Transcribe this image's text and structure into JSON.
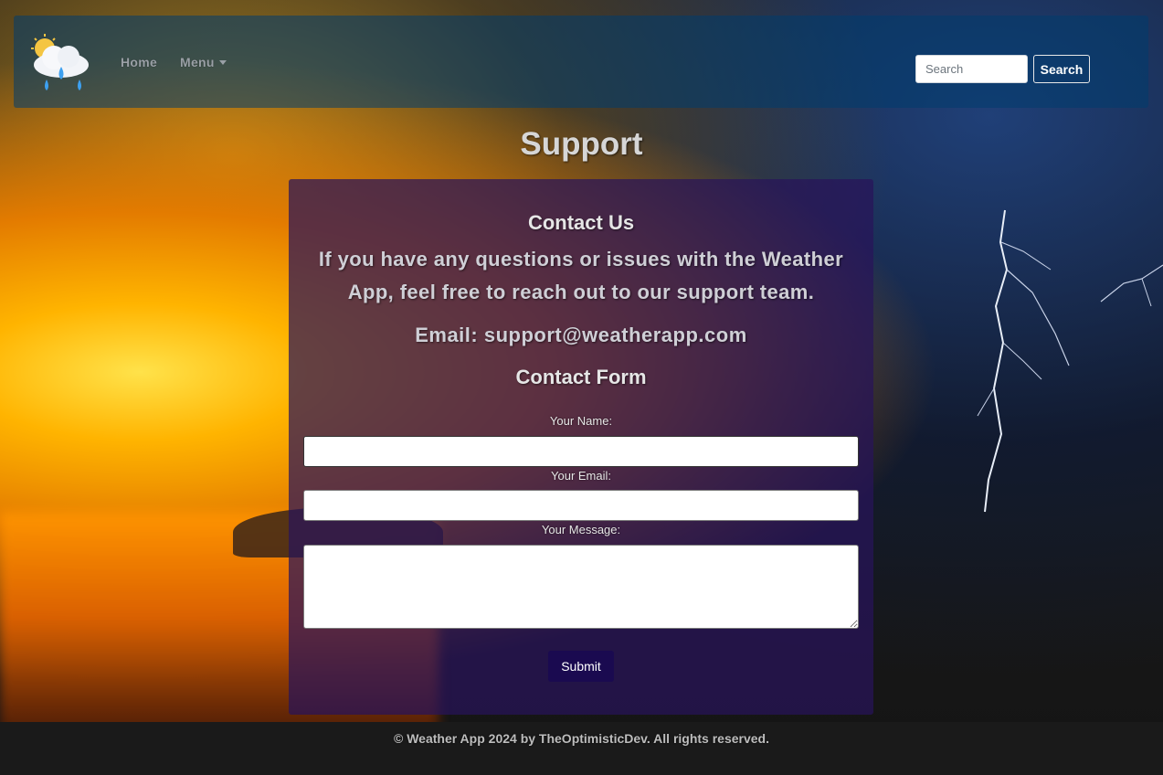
{
  "nav": {
    "home_label": "Home",
    "menu_label": "Menu",
    "logo_icon": "weather-cloud-rain-sun-icon"
  },
  "search": {
    "placeholder": "Search",
    "value": "",
    "button_label": "Search"
  },
  "page": {
    "title": "Support"
  },
  "contact": {
    "title": "Contact Us",
    "intro": "If you have any questions or issues with the Weather App, feel free to reach out to our support team.",
    "email": "Email: support@weatherapp.com"
  },
  "form": {
    "title": "Contact Form",
    "name_label": "Your Name:",
    "name_value": "",
    "email_label": "Your Email:",
    "email_value": "",
    "message_label": "Your Message:",
    "message_value": "",
    "submit_label": "Submit"
  },
  "footer": {
    "text": "© Weather App 2024 by TheOptimisticDev. All rights reserved."
  },
  "colors": {
    "navbar": "#003c6e",
    "card": "#28145a",
    "submit": "#1a0a50"
  }
}
